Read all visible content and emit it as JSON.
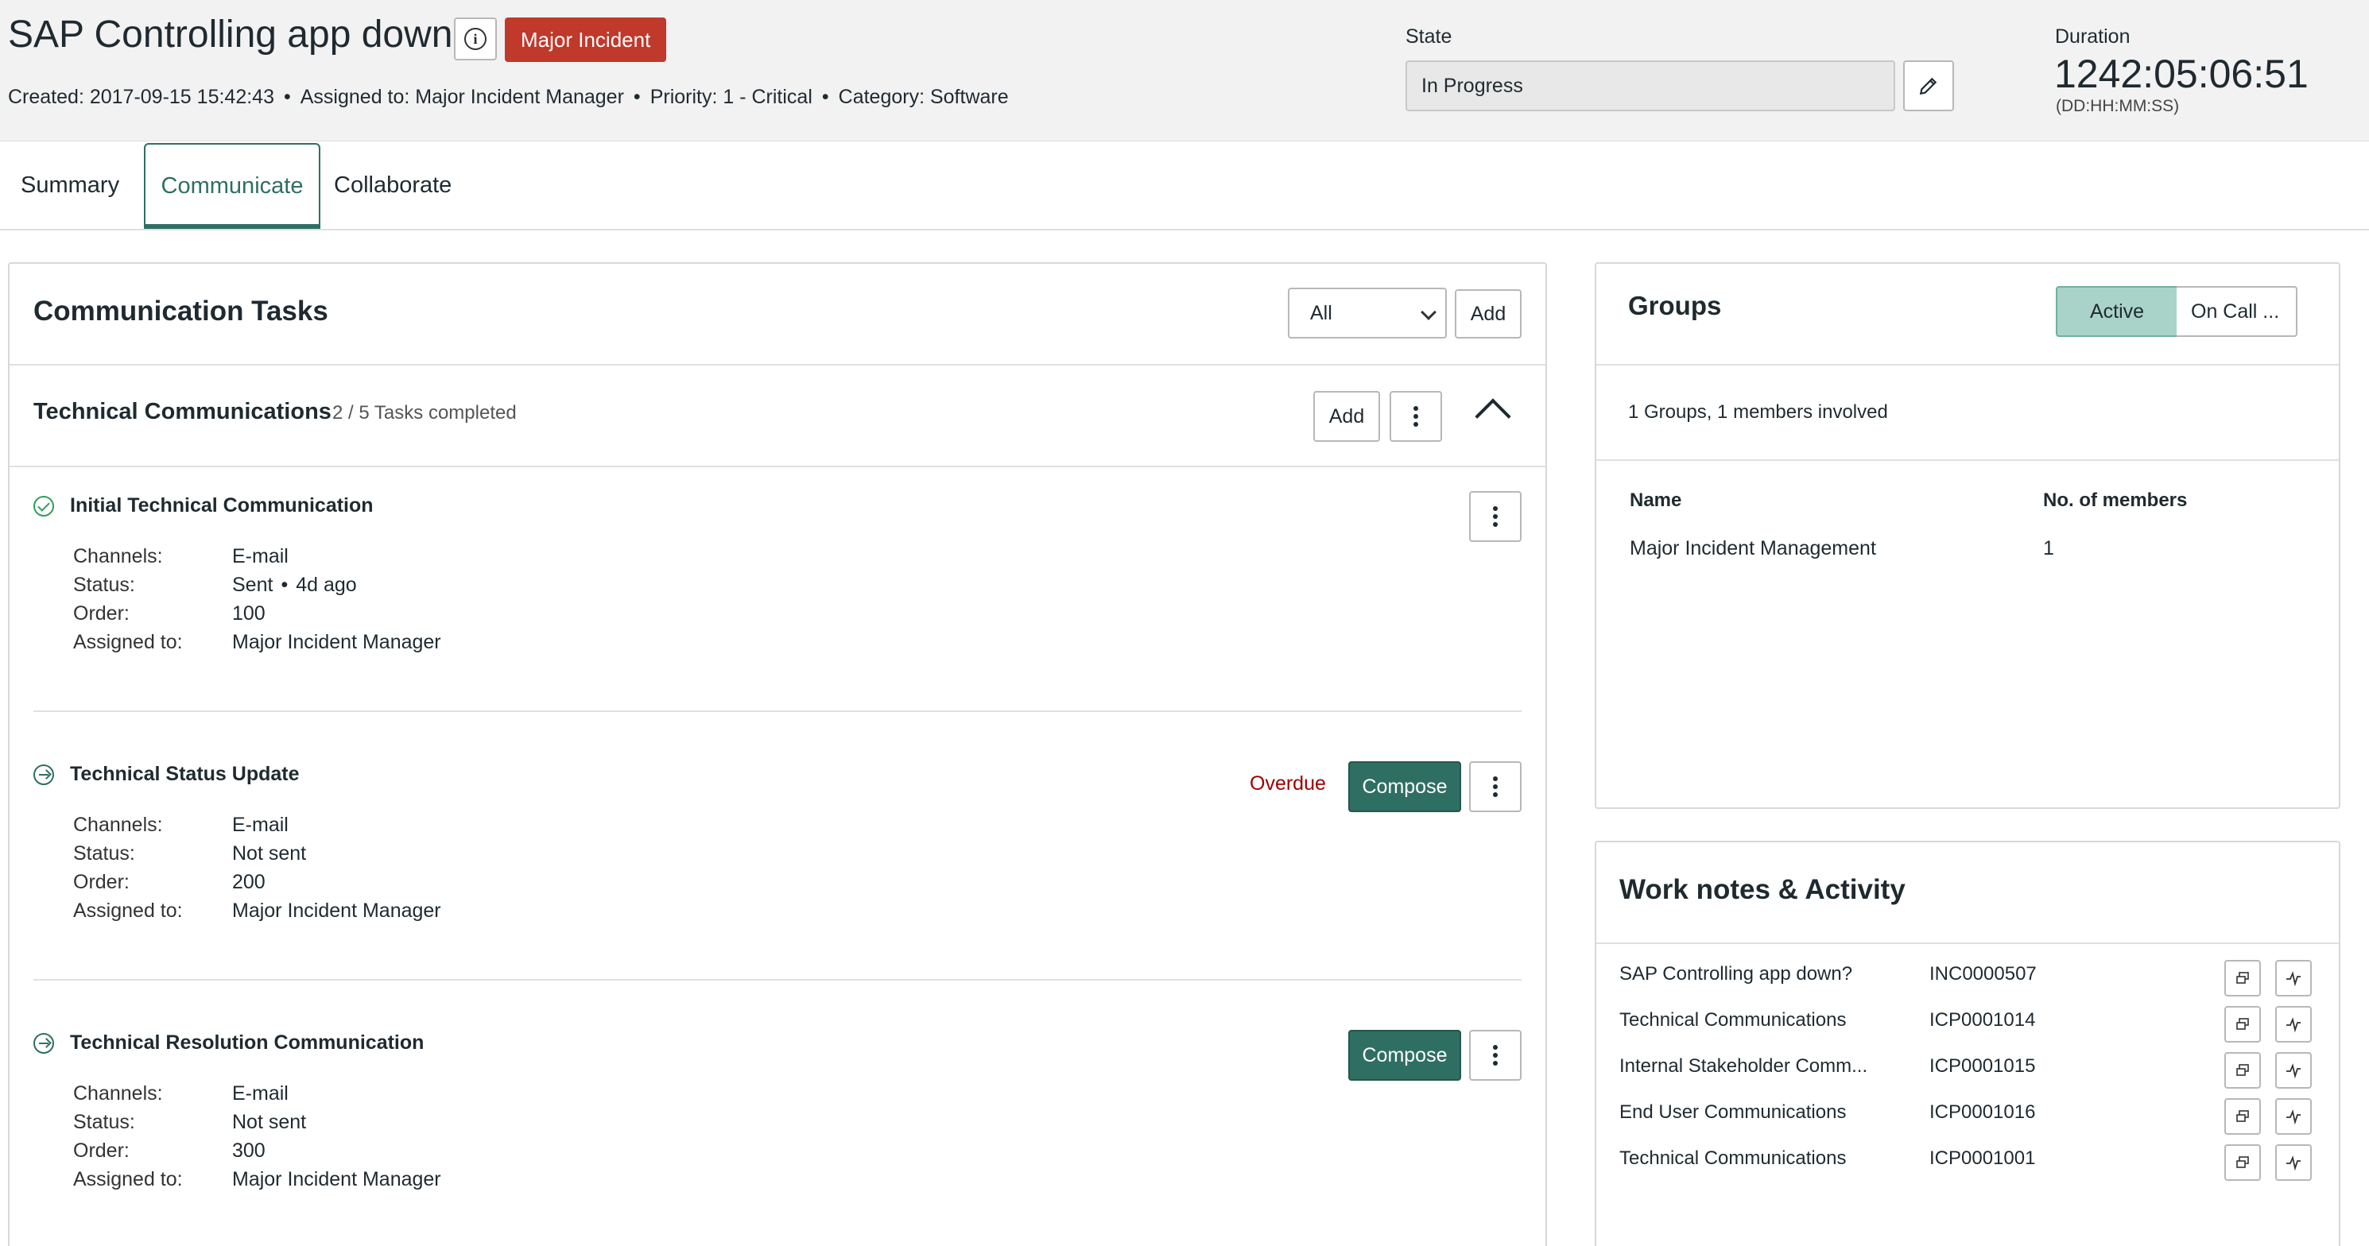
{
  "header": {
    "title": "SAP Controlling app down?",
    "badge": "Major Incident",
    "meta": {
      "created": "Created: 2017-09-15 15:42:43",
      "assigned": "Assigned to: Major Incident Manager",
      "priority": "Priority: 1 - Critical",
      "category": "Category: Software"
    },
    "state_label": "State",
    "state_value": "In Progress",
    "duration_label": "Duration",
    "duration_value": "1242:05:06:51",
    "duration_unit": "(DD:HH:MM:SS)"
  },
  "tabs": [
    {
      "label": "Summary"
    },
    {
      "label": "Communicate"
    },
    {
      "label": "Collaborate"
    }
  ],
  "comm": {
    "title": "Communication Tasks",
    "filter_value": "All",
    "add_label": "Add",
    "section_title": "Technical Communications",
    "section_sub": "2 / 5 Tasks completed",
    "section_add": "Add",
    "labels": {
      "channels": "Channels:",
      "status": "Status:",
      "order": "Order:",
      "assigned": "Assigned to:"
    },
    "tasks": [
      {
        "title": "Initial Technical Communication",
        "channels": "E-mail",
        "status": "Sent",
        "status_extra": "4d ago",
        "order": "100",
        "assigned": "Major Incident Manager"
      },
      {
        "title": "Technical Status Update",
        "channels": "E-mail",
        "status": "Not sent",
        "order": "200",
        "assigned": "Major Incident Manager",
        "overdue": "Overdue",
        "compose": "Compose"
      },
      {
        "title": "Technical Resolution Communication",
        "channels": "E-mail",
        "status": "Not sent",
        "order": "300",
        "assigned": "Major Incident Manager",
        "compose": "Compose"
      }
    ]
  },
  "groups": {
    "title": "Groups",
    "toggle_active": "Active",
    "toggle_other": "On Call ...",
    "summary": "1 Groups, 1 members involved",
    "col_name": "Name",
    "col_members": "No. of members",
    "rows": [
      {
        "name": "Major Incident Management",
        "members": "1"
      }
    ]
  },
  "worknotes": {
    "title": "Work notes & Activity",
    "items": [
      {
        "name": "SAP Controlling app down?",
        "number": "INC0000507"
      },
      {
        "name": "Technical Communications",
        "number": "ICP0001014"
      },
      {
        "name": "Internal Stakeholder Comm...",
        "number": "ICP0001015"
      },
      {
        "name": "End User Communications",
        "number": "ICP0001016"
      },
      {
        "name": "Technical Communications",
        "number": "ICP0001001"
      }
    ]
  },
  "colors": {
    "accent": "#2f6f63",
    "badge": "#c0392b",
    "overdue": "#a00000",
    "active_toggle": "#a9d3c9"
  }
}
